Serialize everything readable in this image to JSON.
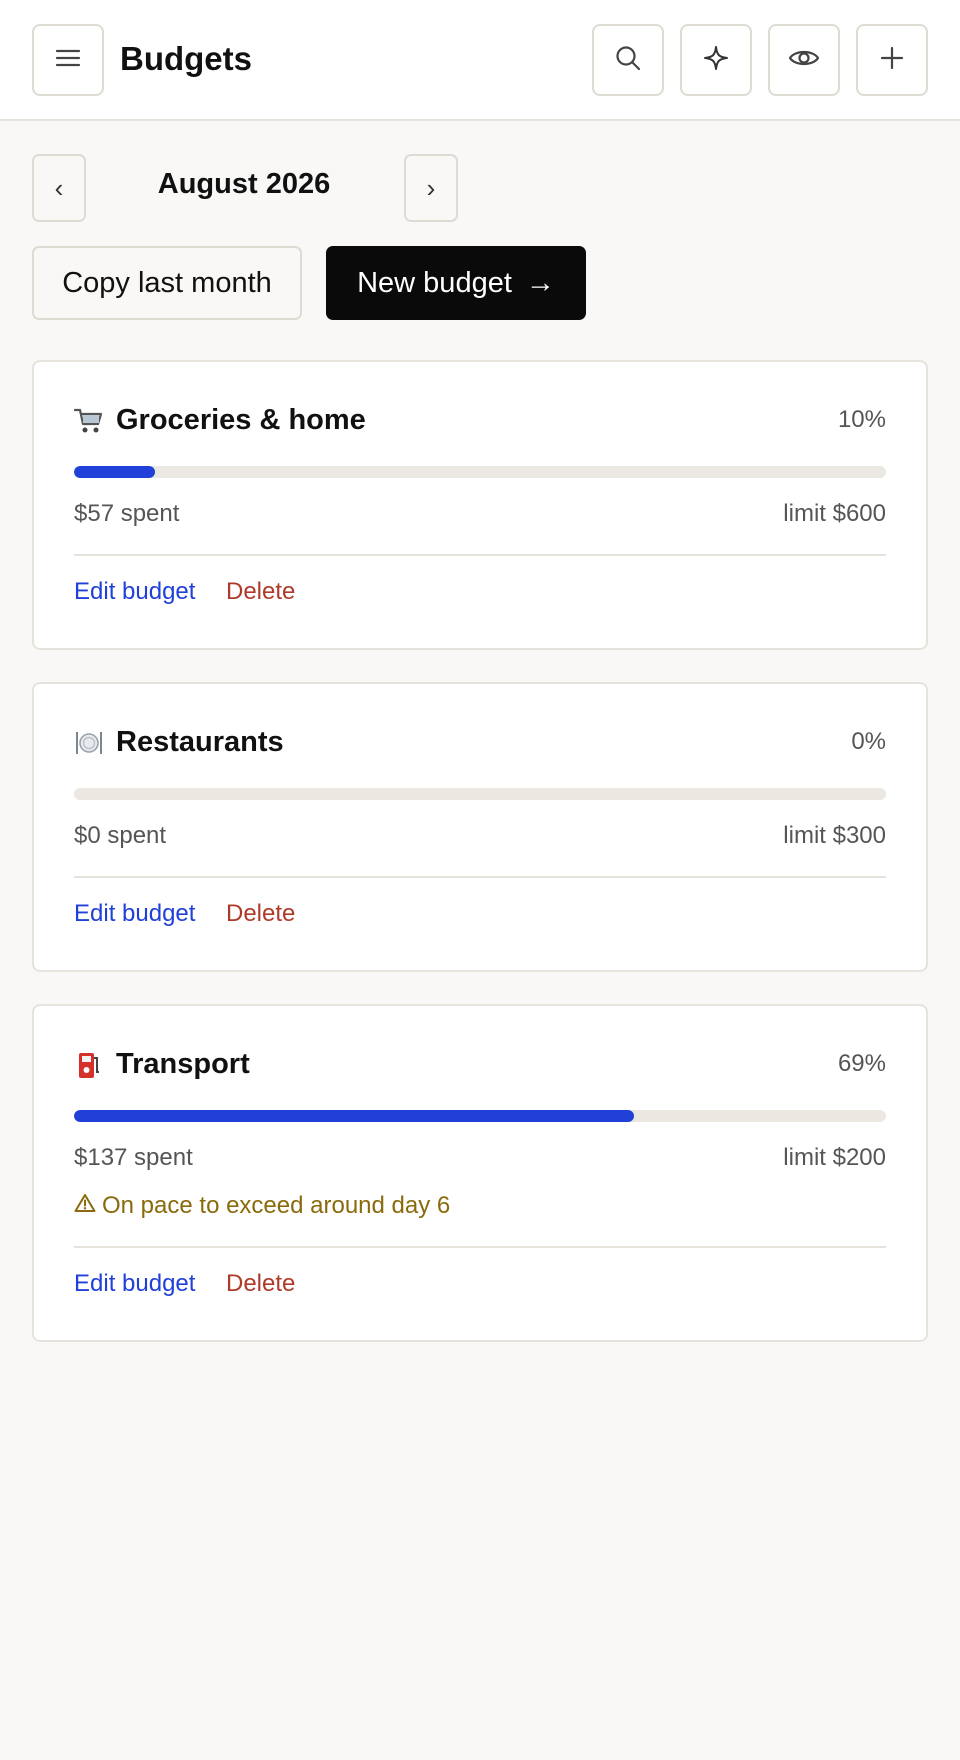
{
  "header": {
    "title": "Budgets",
    "menu_icon": "hamburger-menu-icon",
    "actions": [
      {
        "icon": "search-icon"
      },
      {
        "icon": "sparkle-icon"
      },
      {
        "icon": "eye-icon"
      },
      {
        "icon": "plus-icon"
      }
    ]
  },
  "month_nav": {
    "prev": "‹",
    "label": "August 2026",
    "next": "›"
  },
  "actions": {
    "copy_label": "Copy last month",
    "new_label": "New budget",
    "new_arrow": "→"
  },
  "colors": {
    "accent": "#2140d8",
    "delete": "#b03a2a",
    "warning": "#8a6a0c",
    "track": "#ebe8e1"
  },
  "budgets": [
    {
      "icon": "shopping-cart-icon",
      "name": "Groceries & home",
      "percent": "10%",
      "progress": 0.1,
      "spent": "$57 spent",
      "limit": "limit $600",
      "edit": "Edit budget",
      "delete": "Delete"
    },
    {
      "icon": "plate-cutlery-icon",
      "name": "Restaurants",
      "percent": "0%",
      "progress": 0.0,
      "spent": "$0 spent",
      "limit": "limit $300",
      "edit": "Edit budget",
      "delete": "Delete"
    },
    {
      "icon": "fuel-pump-icon",
      "name": "Transport",
      "percent": "69%",
      "progress": 0.69,
      "spent": "$137 spent",
      "limit": "limit $200",
      "warning_icon": "warning-triangle-icon",
      "warning": "On pace to exceed around day 6",
      "edit": "Edit budget",
      "delete": "Delete"
    }
  ]
}
